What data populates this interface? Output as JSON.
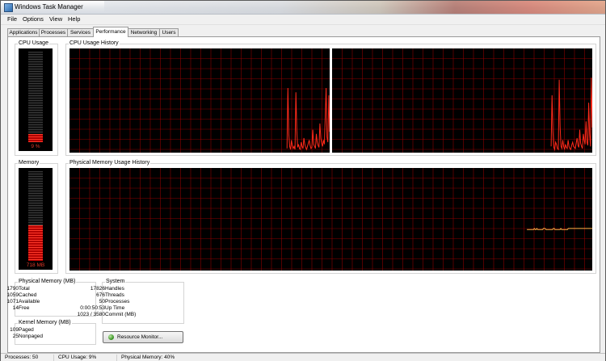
{
  "window": {
    "title": "Windows Task Manager"
  },
  "menu": [
    "File",
    "Options",
    "View",
    "Help"
  ],
  "tabs": [
    {
      "label": "Applications",
      "active": false
    },
    {
      "label": "Processes",
      "active": false
    },
    {
      "label": "Services",
      "active": false
    },
    {
      "label": "Performance",
      "active": true
    },
    {
      "label": "Networking",
      "active": false
    },
    {
      "label": "Users",
      "active": false
    }
  ],
  "cpu_usage": {
    "label": "CPU Usage",
    "value_text": "9 %",
    "percent": 9
  },
  "cpu_history": {
    "label": "CPU Usage History",
    "core1": [
      0,
      0,
      0,
      0,
      0,
      0,
      0,
      0,
      0,
      0,
      0,
      0,
      0,
      0,
      0,
      0,
      0,
      0,
      0,
      0,
      0,
      0,
      0,
      0,
      0,
      0,
      0,
      0,
      0,
      0,
      0,
      0,
      0,
      0,
      0,
      0,
      0,
      0,
      0,
      0,
      0,
      0,
      0,
      0,
      0,
      0,
      0,
      0,
      0,
      0,
      0,
      0,
      0,
      0,
      0,
      0,
      0,
      0,
      0,
      0,
      0,
      0,
      0,
      0,
      0,
      0,
      0,
      0,
      0,
      0,
      0,
      0,
      0,
      0,
      0,
      0,
      0,
      0,
      0,
      0,
      0,
      0,
      0,
      0,
      0,
      0,
      0,
      0,
      0,
      0,
      0,
      0,
      0,
      0,
      0,
      0,
      0,
      0,
      0,
      0,
      0,
      0,
      0,
      0,
      0,
      0,
      0,
      0,
      0,
      0,
      0,
      0,
      0,
      0,
      0,
      0,
      0,
      0,
      0,
      0,
      0,
      0,
      0,
      0,
      0,
      0,
      0,
      0,
      0,
      0,
      0,
      0,
      0,
      0,
      0,
      0,
      0,
      0,
      0,
      0,
      0,
      0,
      0,
      0,
      0,
      0,
      0,
      0,
      0,
      0,
      0,
      0,
      0,
      0,
      0,
      0,
      0,
      0,
      0,
      0,
      0,
      0,
      0,
      0,
      0,
      0,
      0,
      0,
      0,
      0,
      0,
      0,
      0,
      0,
      0,
      0,
      0,
      0,
      0,
      0,
      0,
      0,
      0,
      0,
      0,
      0,
      0,
      0,
      0,
      0,
      0,
      0,
      0,
      0,
      0,
      0,
      0,
      0,
      0,
      0,
      0,
      0,
      0,
      0,
      0,
      0,
      0,
      0,
      0,
      0,
      0,
      0,
      0,
      0,
      0,
      0,
      0,
      0,
      0,
      0,
      0,
      0,
      0,
      0,
      0,
      0,
      0,
      0,
      0,
      0,
      0,
      0,
      0,
      0,
      0,
      0,
      0,
      0,
      0,
      0,
      0,
      0,
      0,
      0,
      0,
      4,
      62,
      18,
      6,
      3,
      12,
      7,
      4,
      6,
      3,
      58,
      22,
      5,
      8,
      4,
      3,
      10,
      6,
      4,
      14,
      8,
      5,
      3,
      6,
      9,
      12,
      7,
      4,
      5,
      22,
      8,
      6,
      4,
      18,
      10,
      7,
      5,
      28,
      14,
      9,
      6,
      12,
      8,
      34,
      62,
      15,
      10,
      55,
      20
    ],
    "core2": [
      0,
      0,
      0,
      0,
      0,
      0,
      0,
      0,
      0,
      0,
      0,
      0,
      0,
      0,
      0,
      0,
      0,
      0,
      0,
      0,
      0,
      0,
      0,
      0,
      0,
      0,
      0,
      0,
      0,
      0,
      0,
      0,
      0,
      0,
      0,
      0,
      0,
      0,
      0,
      0,
      0,
      0,
      0,
      0,
      0,
      0,
      0,
      0,
      0,
      0,
      0,
      0,
      0,
      0,
      0,
      0,
      0,
      0,
      0,
      0,
      0,
      0,
      0,
      0,
      0,
      0,
      0,
      0,
      0,
      0,
      0,
      0,
      0,
      0,
      0,
      0,
      0,
      0,
      0,
      0,
      0,
      0,
      0,
      0,
      0,
      0,
      0,
      0,
      0,
      0,
      0,
      0,
      0,
      0,
      0,
      0,
      0,
      0,
      0,
      0,
      0,
      0,
      0,
      0,
      0,
      0,
      0,
      0,
      0,
      0,
      0,
      0,
      0,
      0,
      0,
      0,
      0,
      0,
      0,
      0,
      0,
      0,
      0,
      0,
      0,
      0,
      0,
      0,
      0,
      0,
      0,
      0,
      0,
      0,
      0,
      0,
      0,
      0,
      0,
      0,
      0,
      0,
      0,
      0,
      0,
      0,
      0,
      0,
      0,
      0,
      0,
      0,
      0,
      0,
      0,
      0,
      0,
      0,
      0,
      0,
      0,
      0,
      0,
      0,
      0,
      0,
      0,
      0,
      0,
      0,
      0,
      0,
      0,
      0,
      0,
      0,
      0,
      0,
      0,
      0,
      0,
      0,
      0,
      0,
      0,
      0,
      0,
      0,
      0,
      0,
      0,
      0,
      0,
      0,
      0,
      0,
      0,
      0,
      0,
      0,
      0,
      0,
      0,
      0,
      0,
      0,
      0,
      0,
      0,
      0,
      0,
      0,
      0,
      0,
      0,
      0,
      0,
      0,
      0,
      0,
      0,
      0,
      0,
      0,
      0,
      0,
      0,
      0,
      0,
      0,
      0,
      0,
      0,
      0,
      0,
      0,
      0,
      0,
      0,
      0,
      0,
      0,
      0,
      0,
      0,
      6,
      55,
      20,
      5,
      3,
      10,
      8,
      4,
      3,
      70,
      25,
      6,
      4,
      12,
      6,
      3,
      8,
      5,
      4,
      12,
      6,
      4,
      3,
      7,
      10,
      6,
      5,
      4,
      9,
      14,
      7,
      5,
      22,
      9,
      6,
      4,
      18,
      12,
      8,
      30,
      10,
      7,
      48,
      18,
      6,
      72,
      24
    ]
  },
  "memory": {
    "label": "Memory",
    "value_text": "718 MB",
    "percent": 40
  },
  "memory_history": {
    "label": "Physical Memory Usage History",
    "values": [
      40,
      40,
      40,
      40,
      40,
      40,
      40,
      40,
      40,
      41,
      40,
      40,
      41,
      40,
      40,
      40,
      40,
      40,
      40,
      40,
      41,
      41,
      41,
      40,
      40,
      40,
      40,
      40,
      40,
      40,
      40,
      40,
      41,
      41,
      40,
      40,
      40,
      40,
      40,
      40,
      40,
      41,
      40,
      40,
      40,
      40,
      40,
      40,
      40,
      40,
      41,
      41,
      41,
      41,
      41,
      41,
      41,
      41,
      41,
      41,
      41,
      41,
      41,
      41,
      41,
      41,
      41,
      41,
      41,
      41,
      41,
      41,
      41,
      41,
      41,
      41,
      41,
      41,
      41,
      41
    ]
  },
  "physical_memory": {
    "title": "Physical Memory (MB)",
    "rows": [
      {
        "key": "Total",
        "value": "1790"
      },
      {
        "key": "Cached",
        "value": "1059"
      },
      {
        "key": "Available",
        "value": "1071"
      },
      {
        "key": "Free",
        "value": "14"
      }
    ]
  },
  "kernel_memory": {
    "title": "Kernel Memory (MB)",
    "rows": [
      {
        "key": "Paged",
        "value": "109"
      },
      {
        "key": "Nonpaged",
        "value": "25"
      }
    ]
  },
  "system": {
    "title": "System",
    "rows": [
      {
        "key": "Handles",
        "value": "17826"
      },
      {
        "key": "Threads",
        "value": "676"
      },
      {
        "key": "Processes",
        "value": "50"
      },
      {
        "key": "Up Time",
        "value": "0:00:50:53"
      },
      {
        "key": "Commit (MB)",
        "value": "1023 / 3580"
      }
    ]
  },
  "resource_monitor_button": "Resource Monitor...",
  "status": {
    "processes": "Processes: 50",
    "cpu_usage": "CPU Usage: 9%",
    "physical_memory": "Physical Memory: 40%"
  },
  "colors": {
    "graph_bg": "#000000",
    "grid": "#8a0000",
    "cpu_line": "#ff2a1a",
    "memory_line": "#ffb347",
    "gauge_text": "#e03a2a"
  }
}
